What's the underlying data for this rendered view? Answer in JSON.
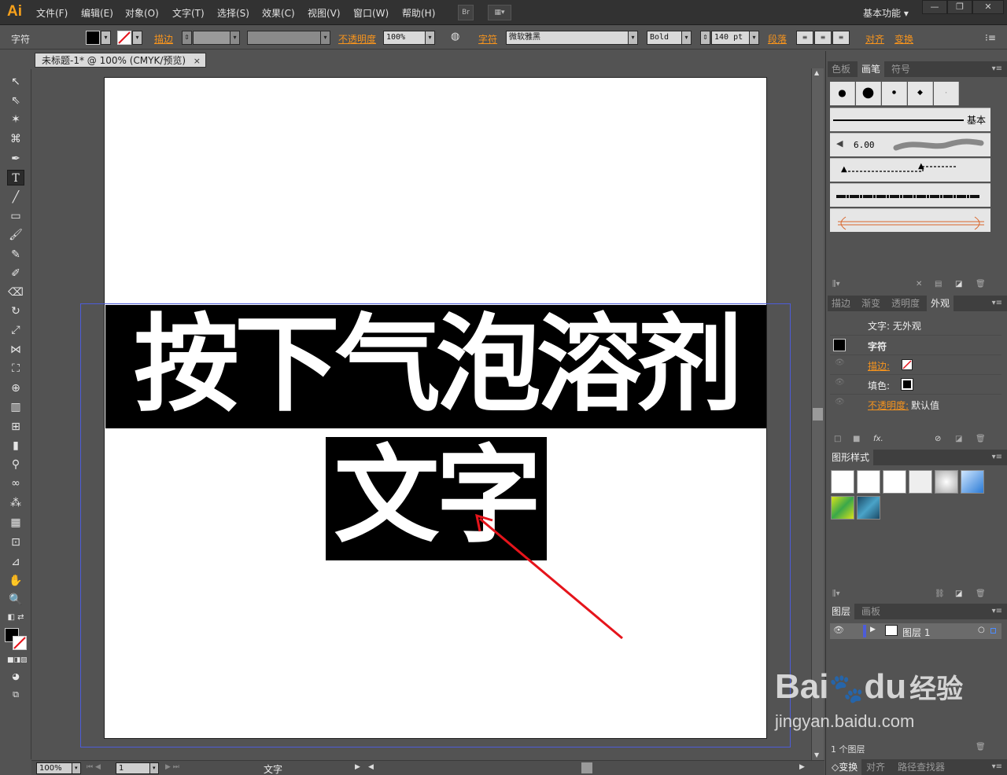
{
  "app": {
    "logo": "Ai",
    "menu": [
      "文件(F)",
      "编辑(E)",
      "对象(O)",
      "文字(T)",
      "选择(S)",
      "效果(C)",
      "视图(V)",
      "窗口(W)",
      "帮助(H)"
    ],
    "bridge_label": "Br",
    "workspace": "基本功能",
    "win_buttons": [
      "—",
      "❐",
      "✕"
    ]
  },
  "control": {
    "type_label": "字符",
    "stroke_label": "描边",
    "opacity_label": "不透明度",
    "opacity_value": "100%",
    "char_label": "字符",
    "font_family": "微软雅黑",
    "font_style": "Bold",
    "font_size": "140 pt",
    "paragraph_label": "段落",
    "align_label": "对齐",
    "transform_label": "变换"
  },
  "document": {
    "tab_title": "未标题-1* @ 100% (CMYK/预览)",
    "tab_close": "×",
    "line1": "按下气泡溶剂",
    "line2": "文字"
  },
  "status": {
    "zoom": "100%",
    "artboard_num": "1",
    "tool_text": "文字"
  },
  "panels": {
    "swatch_tabs": [
      "色板",
      "画笔",
      "符号"
    ],
    "brush_basic": "基本",
    "brush_size": "6.00",
    "appear_tabs": [
      "描边",
      "渐变",
      "透明度",
      "外观"
    ],
    "appear_top": "文字: 无外观",
    "appear_char": "字符",
    "appear_stroke": "描边:",
    "appear_fill": "填色:",
    "appear_opacity": "不透明度:",
    "appear_opacity_val": "默认值",
    "styles_tab": "图形样式",
    "layer_tabs": [
      "图层",
      "画板"
    ],
    "layer_name": "图层 1",
    "layer_count": "1 个图层",
    "bottom_tabs": [
      "◇变换",
      "对齐",
      "路径查找器"
    ]
  },
  "watermark": {
    "brand": "Bai",
    "brand2": "du",
    "cn": "经验",
    "url": "jingyan.baidu.com"
  },
  "colors": {
    "accent_orange": "#f7941d",
    "logo_orange": "#f7a11b",
    "arrow_red": "#e5141b",
    "bleed_blue": "#4d5cd9"
  }
}
